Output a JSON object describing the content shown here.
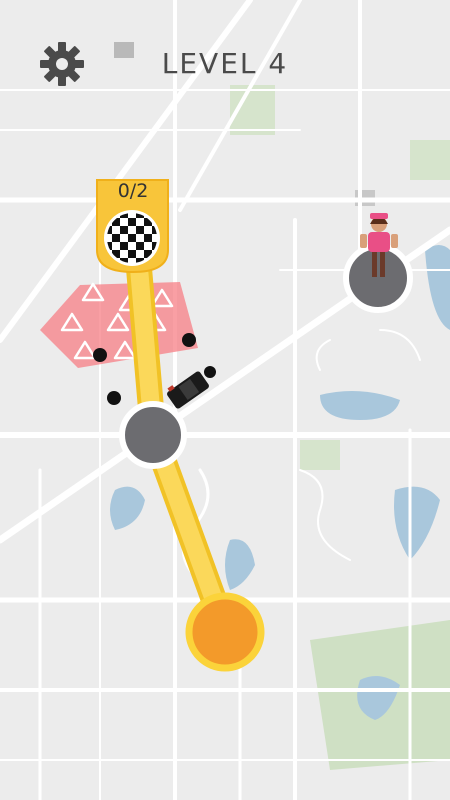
{
  "hud": {
    "level_label": "LEVEL 4",
    "settings_icon": "gear-icon"
  },
  "goal": {
    "progress_label": "0/2",
    "icon": "checkered-flag-icon",
    "delivered": 0,
    "total": 2
  },
  "colors": {
    "map_bg": "#ececec",
    "road": "#ffffff",
    "water": "#a9c7dc",
    "park": "#cfe0c4",
    "path": "#fbd85a",
    "path_outline": "#f1c226",
    "start_node": "#f39a2a",
    "node_gray": "#6c6c70",
    "danger_zone": "#f77f86",
    "flag_banner": "#f8c53a"
  }
}
